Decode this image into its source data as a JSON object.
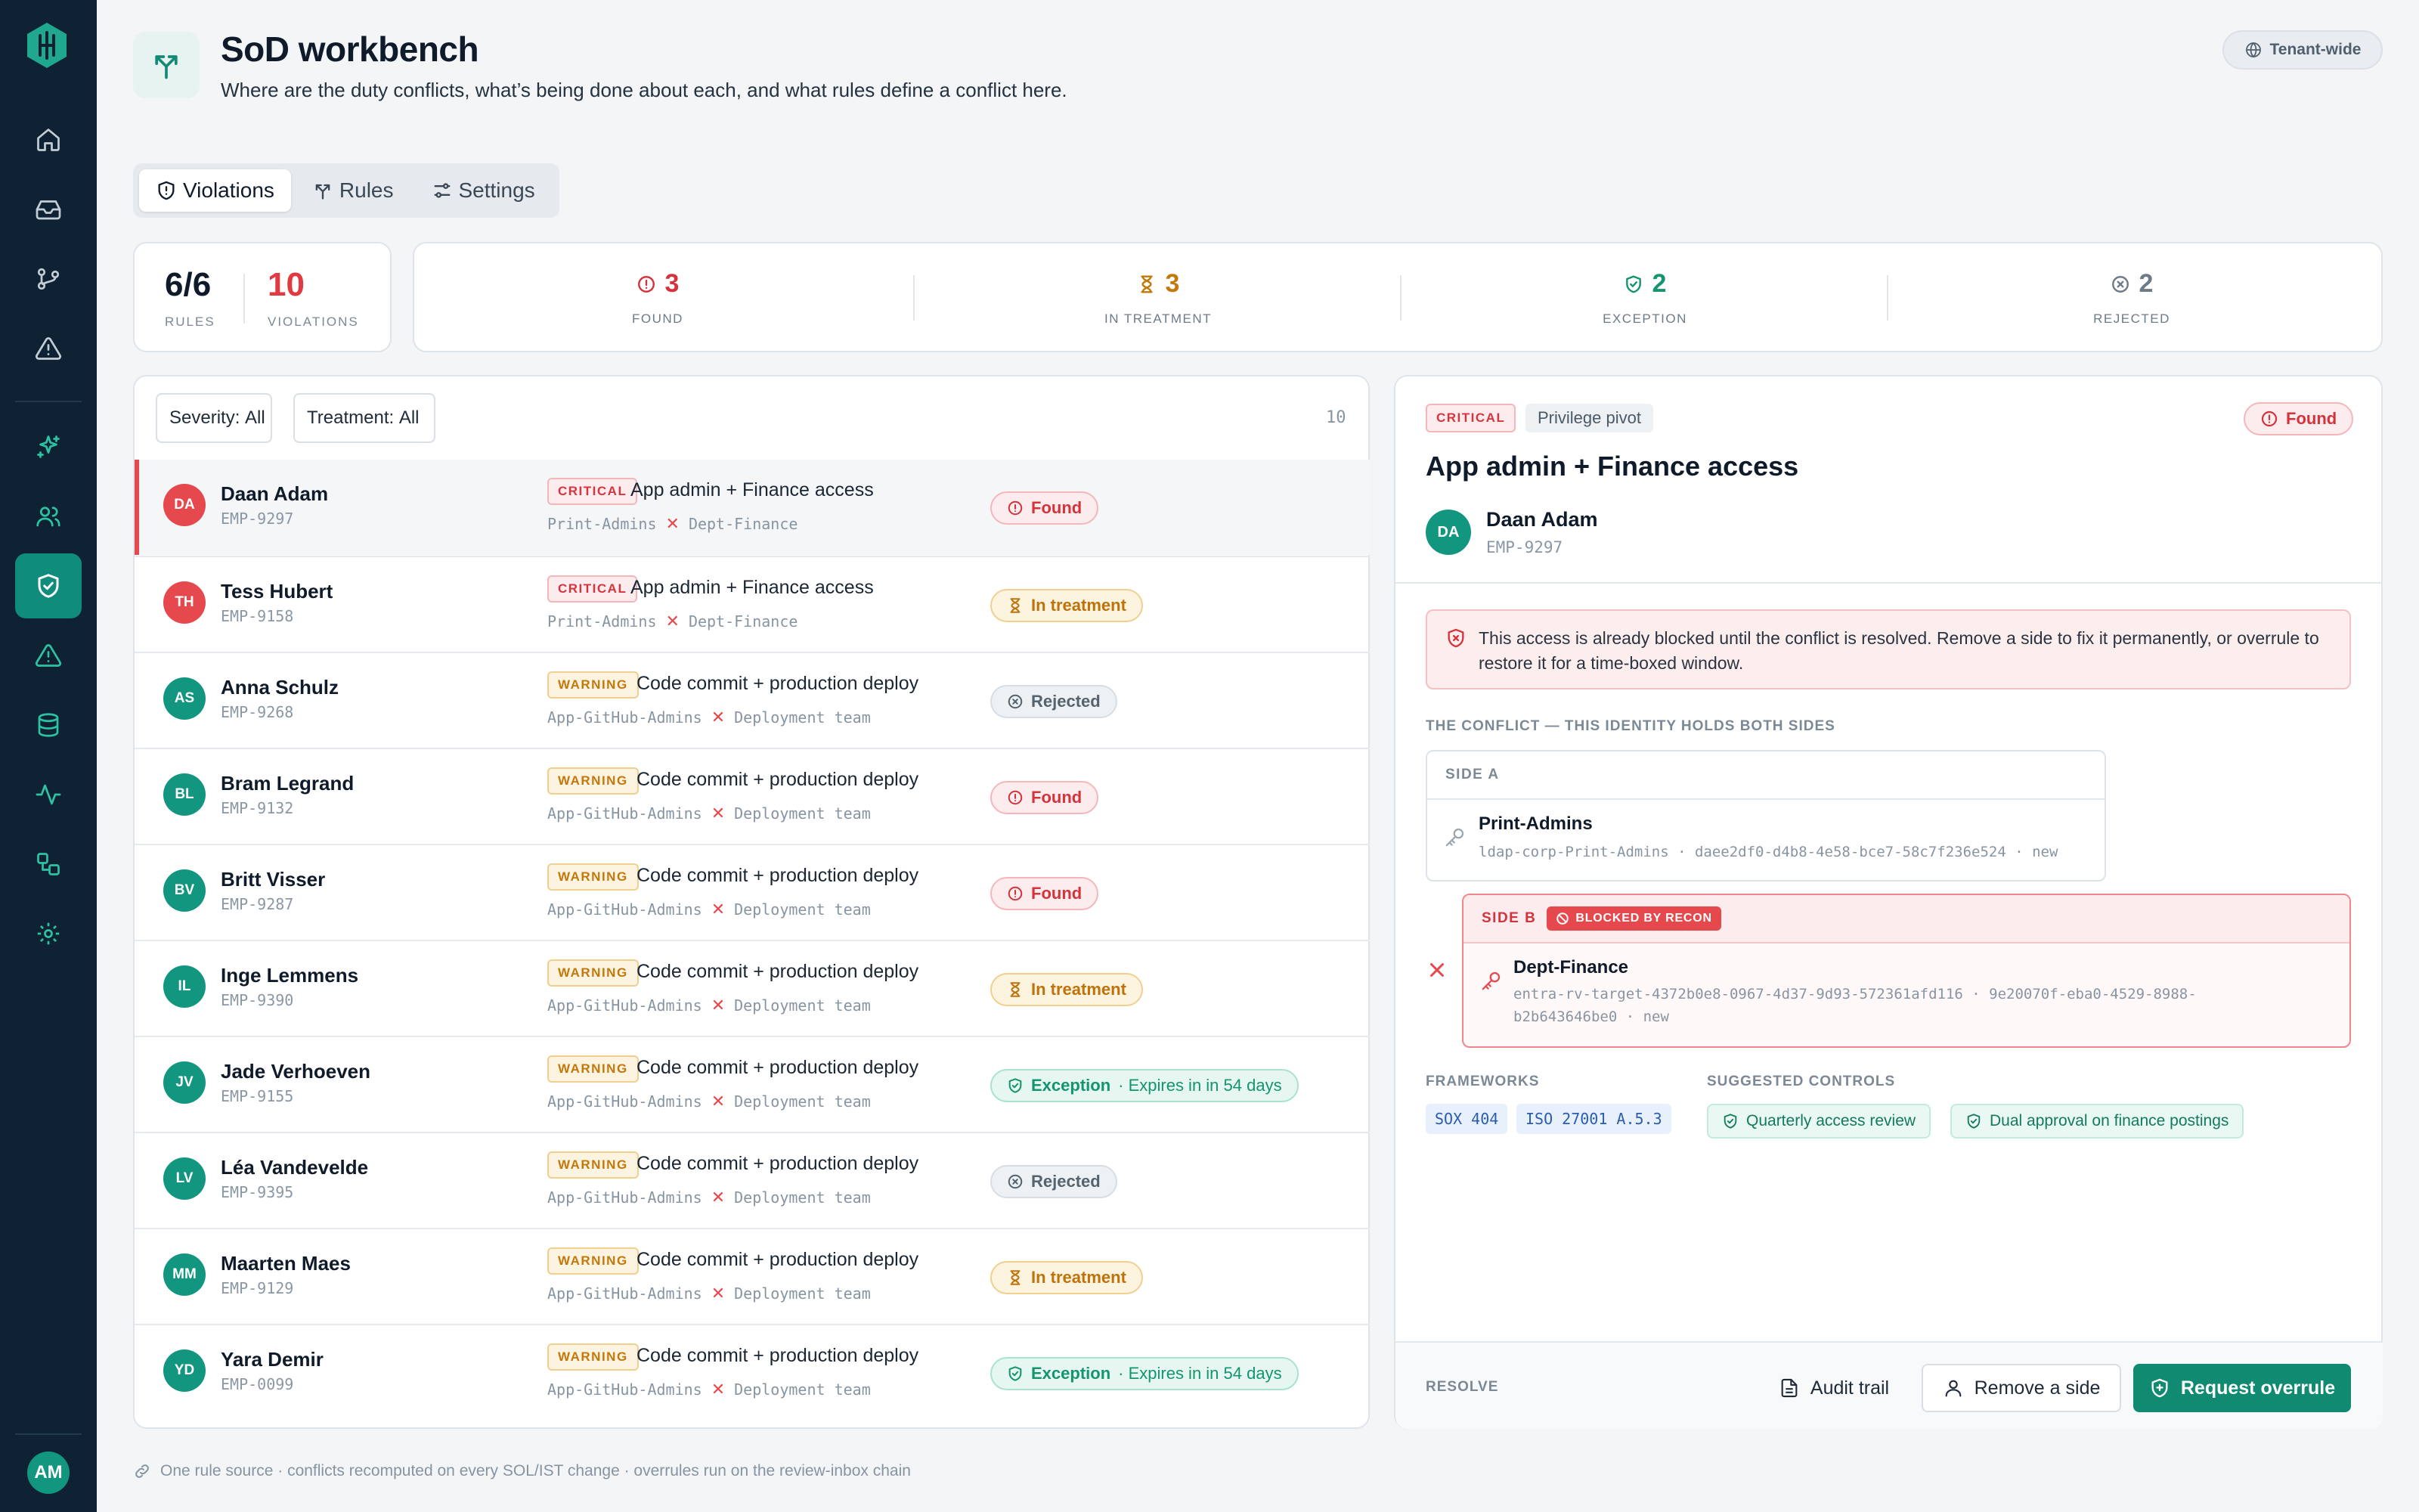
{
  "header": {
    "title": "SoD workbench",
    "subtitle": "Where are the duty conflicts, what’s being done about each, and what rules define a conflict here.",
    "scope": "Tenant-wide"
  },
  "sidebar": {
    "items": [
      "home",
      "inbox",
      "git-branch",
      "alert-triangle",
      "sparkles",
      "users",
      "shield-check",
      "alert-triangle",
      "database",
      "activity",
      "workflow",
      "settings"
    ],
    "active": "shield-check",
    "user_initials": "AM"
  },
  "tabs": [
    {
      "label": "Violations",
      "active": true
    },
    {
      "label": "Rules",
      "active": false
    },
    {
      "label": "Settings",
      "active": false
    }
  ],
  "kpis": {
    "rules_value": "6/6",
    "rules_label": "RULES",
    "violations_value": "10",
    "violations_label": "VIOLATIONS"
  },
  "stats": [
    {
      "value": "3",
      "label": "FOUND",
      "color": "#d4333c"
    },
    {
      "value": "3",
      "label": "IN TREATMENT",
      "color": "#c5780a"
    },
    {
      "value": "2",
      "label": "EXCEPTION",
      "color": "#14946f"
    },
    {
      "value": "2",
      "label": "REJECTED",
      "color": "#6d7a88"
    }
  ],
  "filters": {
    "severity_label": "Severity:",
    "severity_value": "All",
    "treatment_label": "Treatment:",
    "treatment_value": "All",
    "count": "10"
  },
  "violations": [
    {
      "initials": "DA",
      "avatar_color": "#e5484d",
      "name": "Daan Adam",
      "emp": "EMP-9297",
      "severity": "CRITICAL",
      "rule": "App admin + Finance access",
      "side_a": "Print-Admins",
      "side_b": "Dept-Finance",
      "status": "Found",
      "status_sub": ""
    },
    {
      "initials": "TH",
      "avatar_color": "#e5484d",
      "name": "Tess Hubert",
      "emp": "EMP-9158",
      "severity": "CRITICAL",
      "rule": "App admin + Finance access",
      "side_a": "Print-Admins",
      "side_b": "Dept-Finance",
      "status": "In treatment",
      "status_sub": ""
    },
    {
      "initials": "AS",
      "avatar_color": "#12967f",
      "name": "Anna Schulz",
      "emp": "EMP-9268",
      "severity": "WARNING",
      "rule": "Code commit + production deploy",
      "side_a": "App-GitHub-Admins",
      "side_b": "Deployment team",
      "status": "Rejected",
      "status_sub": ""
    },
    {
      "initials": "BL",
      "avatar_color": "#12967f",
      "name": "Bram Legrand",
      "emp": "EMP-9132",
      "severity": "WARNING",
      "rule": "Code commit + production deploy",
      "side_a": "App-GitHub-Admins",
      "side_b": "Deployment team",
      "status": "Found",
      "status_sub": ""
    },
    {
      "initials": "BV",
      "avatar_color": "#12967f",
      "name": "Britt Visser",
      "emp": "EMP-9287",
      "severity": "WARNING",
      "rule": "Code commit + production deploy",
      "side_a": "App-GitHub-Admins",
      "side_b": "Deployment team",
      "status": "Found",
      "status_sub": ""
    },
    {
      "initials": "IL",
      "avatar_color": "#12967f",
      "name": "Inge Lemmens",
      "emp": "EMP-9390",
      "severity": "WARNING",
      "rule": "Code commit + production deploy",
      "side_a": "App-GitHub-Admins",
      "side_b": "Deployment team",
      "status": "In treatment",
      "status_sub": ""
    },
    {
      "initials": "JV",
      "avatar_color": "#12967f",
      "name": "Jade Verhoeven",
      "emp": "EMP-9155",
      "severity": "WARNING",
      "rule": "Code commit + production deploy",
      "side_a": "App-GitHub-Admins",
      "side_b": "Deployment team",
      "status": "Exception",
      "status_sub": "· Expires in in 54 days"
    },
    {
      "initials": "LV",
      "avatar_color": "#12967f",
      "name": "Léa Vandevelde",
      "emp": "EMP-9395",
      "severity": "WARNING",
      "rule": "Code commit + production deploy",
      "side_a": "App-GitHub-Admins",
      "side_b": "Deployment team",
      "status": "Rejected",
      "status_sub": ""
    },
    {
      "initials": "MM",
      "avatar_color": "#12967f",
      "name": "Maarten Maes",
      "emp": "EMP-9129",
      "severity": "WARNING",
      "rule": "Code commit + production deploy",
      "side_a": "App-GitHub-Admins",
      "side_b": "Deployment team",
      "status": "In treatment",
      "status_sub": ""
    },
    {
      "initials": "YD",
      "avatar_color": "#12967f",
      "name": "Yara Demir",
      "emp": "EMP-0099",
      "severity": "WARNING",
      "rule": "Code commit + production deploy",
      "side_a": "App-GitHub-Admins",
      "side_b": "Deployment team",
      "status": "Exception",
      "status_sub": "· Expires in in 54 days"
    }
  ],
  "detail": {
    "severity": "CRITICAL",
    "type": "Privilege pivot",
    "status": "Found",
    "title": "App admin + Finance access",
    "initials": "DA",
    "name": "Daan Adam",
    "emp": "EMP-9297",
    "alert": "This access is already blocked until the conflict is resolved. Remove a side to fix it permanently, or overrule to restore it for a time-boxed window.",
    "conflict_label": "THE CONFLICT — THIS IDENTITY HOLDS BOTH SIDES",
    "side_a": {
      "label": "SIDE A",
      "name": "Print-Admins",
      "meta": "ldap-corp-Print-Admins · daee2df0-d4b8-4e58-bce7-58c7f236e524 · new"
    },
    "side_b": {
      "label": "SIDE B",
      "badge": "BLOCKED BY RECON",
      "name": "Dept-Finance",
      "meta_line1": "entra-rv-target-4372b0e8-0967-4d37-9d93-572361afd116 · 9e20070f-eba0-4529-8988-",
      "meta_line2": "b2b643646be0 · new"
    },
    "frameworks_label": "FRAMEWORKS",
    "frameworks": [
      "SOX 404",
      "ISO 27001 A.5.3"
    ],
    "controls_label": "SUGGESTED CONTROLS",
    "controls": [
      "Quarterly access review",
      "Dual approval on finance postings"
    ],
    "resolve_label": "RESOLVE",
    "audit_btn": "Audit trail",
    "remove_btn": "Remove a side",
    "overrule_btn": "Request overrule"
  },
  "footer_note": "One rule source · conflicts recomputed on every SOL/IST change · overrules run on the review-inbox chain"
}
